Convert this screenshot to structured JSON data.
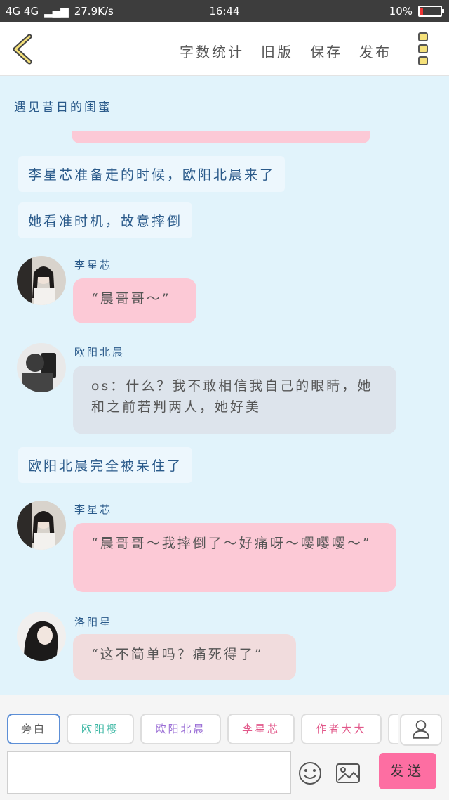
{
  "status": {
    "network": "4G 4G",
    "speed": "27.9K/s",
    "time": "16:44",
    "battery": "10%"
  },
  "toolbar": {
    "word_count": "字数统计",
    "old_version": "旧版",
    "save": "保存",
    "publish": "发布"
  },
  "story": {
    "title": "遇见昔日的闺蜜"
  },
  "messages": [
    {
      "type": "narration",
      "text": "李星芯准备走的时候，欧阳北晨来了"
    },
    {
      "type": "narration",
      "text": "她看准时机，故意摔倒"
    },
    {
      "type": "dialogue",
      "name": "李星芯",
      "text": "“晨哥哥～”"
    },
    {
      "type": "dialogue",
      "name": "欧阳北晨",
      "text": "os：什么？我不敢相信我自己的眼睛，她和之前若判两人，她好美"
    },
    {
      "type": "narration",
      "text": "欧阳北晨完全被呆住了"
    },
    {
      "type": "dialogue",
      "name": "李星芯",
      "text": "“晨哥哥～我摔倒了～好痛呀～嘤嘤嘤～”"
    },
    {
      "type": "dialogue",
      "name": "洛阳星",
      "text": "“这不简单吗？痛死得了”"
    }
  ],
  "characters": [
    "旁白",
    "欧阳樱",
    "欧阳北晨",
    "李星芯",
    "作者大大"
  ],
  "character_colors": [
    "#555555",
    "#3fb8a5",
    "#9b6fd6",
    "#e2588a",
    "#e2588a"
  ],
  "colors": {
    "pink_bubble": "#fcc9d6",
    "gray_bubble": "#dde4ec",
    "rose_bubble": "#f1dcdd",
    "narration_bg": "#edf7fd",
    "send": "#fd6ea2"
  },
  "input": {
    "placeholder": ""
  },
  "send_label": "发送"
}
